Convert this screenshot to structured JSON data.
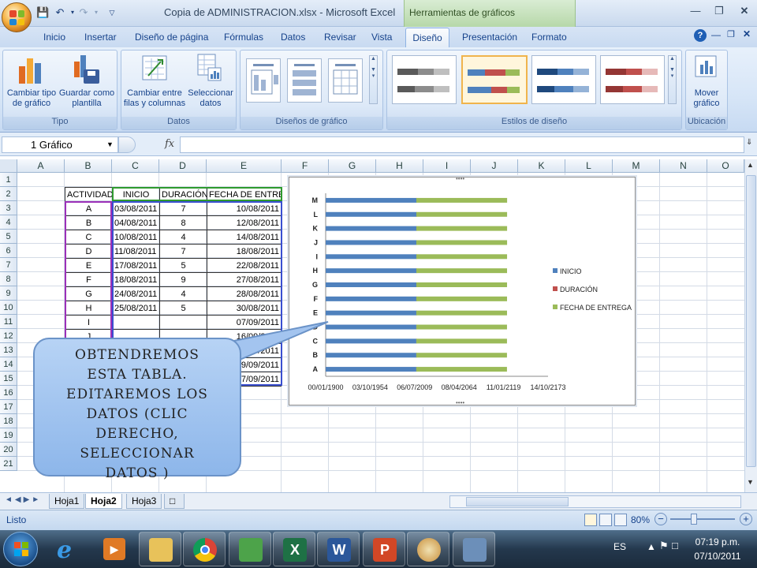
{
  "window": {
    "title": "Copia de ADMINISTRACION.xlsx - Microsoft Excel",
    "context_tab_title": "Herramientas de gráficos"
  },
  "ribbon_tabs": [
    "Inicio",
    "Insertar",
    "Diseño de página",
    "Fórmulas",
    "Datos",
    "Revisar",
    "Vista",
    "Diseño",
    "Presentación",
    "Formato"
  ],
  "active_tab": "Diseño",
  "groups": {
    "tipo": {
      "label": "Tipo",
      "btn1": [
        "Cambiar tipo",
        "de gráfico"
      ],
      "btn2": [
        "Guardar como",
        "plantilla"
      ]
    },
    "datos": {
      "label": "Datos",
      "btn1": [
        "Cambiar entre",
        "filas y columnas"
      ],
      "btn2": [
        "Seleccionar",
        "datos"
      ]
    },
    "disenos": {
      "label": "Diseños de gráfico"
    },
    "estilos": {
      "label": "Estilos de diseño"
    },
    "ubicacion": {
      "label": "Ubicación",
      "btn": [
        "Mover",
        "gráfico"
      ]
    }
  },
  "name_box": "1 Gráfico",
  "fx_symbol": "fx",
  "columns": [
    "A",
    "B",
    "C",
    "D",
    "E",
    "F",
    "G",
    "H",
    "I",
    "J",
    "K",
    "L",
    "M",
    "N",
    "O"
  ],
  "rows": [
    "1",
    "2",
    "3",
    "4",
    "5",
    "6",
    "7",
    "8",
    "9",
    "10",
    "11",
    "12",
    "13",
    "14",
    "15",
    "16",
    "17",
    "18",
    "19",
    "20",
    "21"
  ],
  "table": {
    "headers": [
      "ACTIVIDAD",
      "INICIO",
      "DURACIÓN",
      "FECHA DE ENTREGA"
    ],
    "rows": [
      [
        "A",
        "03/08/2011",
        "7",
        "10/08/2011"
      ],
      [
        "B",
        "04/08/2011",
        "8",
        "12/08/2011"
      ],
      [
        "C",
        "10/08/2011",
        "4",
        "14/08/2011"
      ],
      [
        "D",
        "11/08/2011",
        "7",
        "18/08/2011"
      ],
      [
        "E",
        "17/08/2011",
        "5",
        "22/08/2011"
      ],
      [
        "F",
        "18/08/2011",
        "9",
        "27/08/2011"
      ],
      [
        "G",
        "24/08/2011",
        "4",
        "28/08/2011"
      ],
      [
        "H",
        "25/08/2011",
        "5",
        "30/08/2011"
      ],
      [
        "I",
        "",
        "",
        "07/09/2011"
      ],
      [
        "J",
        "",
        "",
        "16/09/2011"
      ],
      [
        "K",
        "",
        "",
        "19/09/2011"
      ],
      [
        "L",
        "",
        "",
        "19/09/2011"
      ],
      [
        "M",
        "",
        "",
        "27/09/2011"
      ]
    ]
  },
  "chart_data": {
    "type": "bar",
    "orientation": "horizontal",
    "stacked": true,
    "categories": [
      "A",
      "B",
      "C",
      "D",
      "E",
      "F",
      "G",
      "H",
      "I",
      "J",
      "K",
      "L",
      "M"
    ],
    "series": [
      {
        "name": "INICIO",
        "color": "#4f81bd",
        "values": [
          40758,
          40759,
          40765,
          40766,
          40772,
          40773,
          40779,
          40780,
          40780,
          40780,
          40780,
          40780,
          40780
        ]
      },
      {
        "name": "DURACIÓN",
        "color": "#c0504d",
        "values": [
          7,
          8,
          4,
          7,
          5,
          9,
          4,
          5,
          5,
          5,
          5,
          5,
          5
        ]
      },
      {
        "name": "FECHA DE ENTREGA",
        "color": "#9bbb59",
        "values": [
          40765,
          40767,
          40769,
          40773,
          40777,
          40782,
          40783,
          40785,
          40793,
          40802,
          40805,
          40805,
          40813
        ]
      }
    ],
    "x_tick_labels": [
      "00/01/1900",
      "03/10/1954",
      "06/07/2009",
      "08/04/2064",
      "11/01/2119",
      "14/10/2173"
    ],
    "xlim": [
      0,
      100000
    ],
    "legend_position": "right"
  },
  "callout_lines": [
    "OBTENDREMOS",
    "ESTA TABLA.",
    "EDITAREMOS LOS",
    "DATOS (CLIC",
    "DERECHO,",
    "SELECCIONAR",
    "DATOS )"
  ],
  "sheets": [
    "Hoja1",
    "Hoja2",
    "Hoja3"
  ],
  "active_sheet": "Hoja2",
  "status_text": "Listo",
  "zoom": "80%",
  "taskbar": {
    "lang": "ES",
    "time": "07:19 p.m.",
    "date": "07/10/2011"
  }
}
